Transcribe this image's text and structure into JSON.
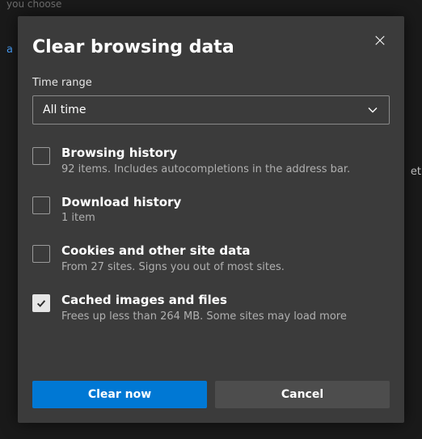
{
  "background": {
    "truncated_top": "you choose",
    "truncated_link": "a",
    "truncated_right": "et"
  },
  "dialog": {
    "title": "Clear browsing data",
    "time_range_label": "Time range",
    "time_range_value": "All time",
    "items": [
      {
        "title": "Browsing history",
        "desc": "92 items. Includes autocompletions in the address bar.",
        "checked": false
      },
      {
        "title": "Download history",
        "desc": "1 item",
        "checked": false
      },
      {
        "title": "Cookies and other site data",
        "desc": "From 27 sites. Signs you out of most sites.",
        "checked": false
      },
      {
        "title": "Cached images and files",
        "desc": "Frees up less than 264 MB. Some sites may load more",
        "checked": true
      }
    ],
    "primary_button": "Clear now",
    "secondary_button": "Cancel"
  }
}
